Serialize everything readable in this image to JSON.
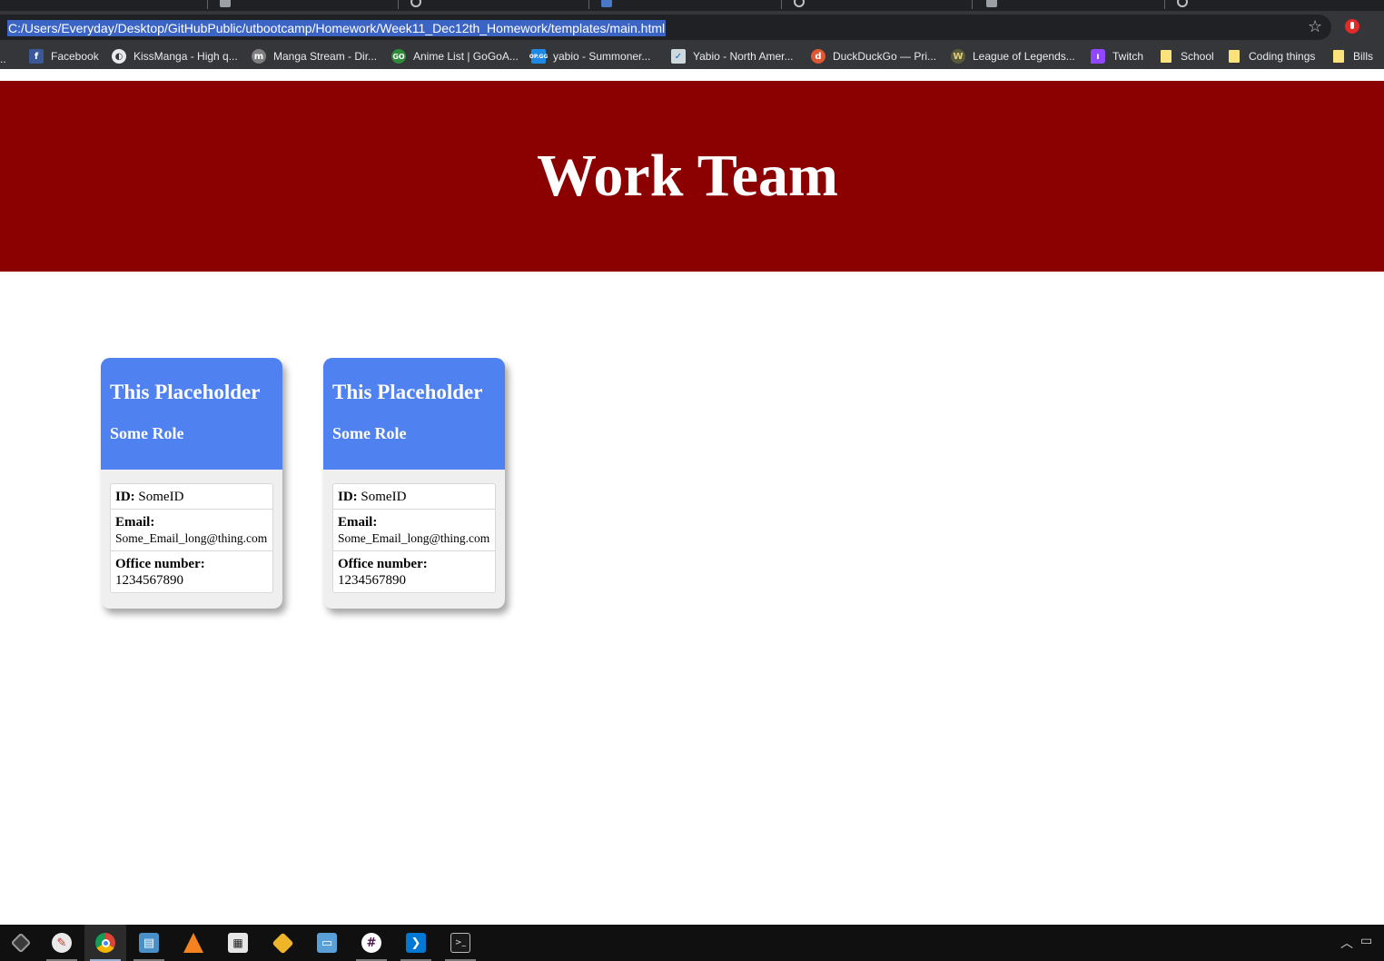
{
  "browser": {
    "url": "C:/Users/Everyday/Desktop/GitHubPublic/utbootcamp/Homework/Week11_Dec12th_Homework/templates/main.html",
    "bookmarks": [
      {
        "label": "Facebook",
        "icon": "facebook-icon"
      },
      {
        "label": "KissManga - High q...",
        "icon": "globe-icon"
      },
      {
        "label": "Manga Stream - Dir...",
        "icon": "manga-stream-icon"
      },
      {
        "label": "Anime List | GoGoA...",
        "icon": "gogoanime-icon"
      },
      {
        "label": "yabio - Summoner...",
        "icon": "opgg-icon"
      },
      {
        "label": "Yabio - North Amer...",
        "icon": "yabio-icon"
      },
      {
        "label": "DuckDuckGo — Pri...",
        "icon": "duckduckgo-icon"
      },
      {
        "label": "League of Legends...",
        "icon": "league-wiki-icon"
      },
      {
        "label": "Twitch",
        "icon": "twitch-icon"
      },
      {
        "label": "School",
        "icon": "folder-icon"
      },
      {
        "label": "Coding things",
        "icon": "folder-icon"
      },
      {
        "label": "Bills",
        "icon": "folder-icon"
      }
    ]
  },
  "page": {
    "title": "Work Team",
    "cards": [
      {
        "name": "This Placeholder",
        "role": "Some Role",
        "id_label": "ID:",
        "id_value": "SomeID",
        "email_label": "Email:",
        "email_value": "Some_Email_long@thing.com",
        "office_label": "Office number:",
        "office_value": "1234567890"
      },
      {
        "name": "This Placeholder",
        "role": "Some Role",
        "id_label": "ID:",
        "id_value": "SomeID",
        "email_label": "Email:",
        "email_value": "Some_Email_long@thing.com",
        "office_label": "Office number:",
        "office_value": "1234567890"
      }
    ]
  },
  "taskbar": {
    "apps": [
      "start-icon",
      "paint-icon",
      "chrome-icon",
      "notes-icon",
      "vlc-icon",
      "calculator-icon",
      "git-icon",
      "chat-icon",
      "slack-icon",
      "vscode-icon",
      "terminal-icon"
    ],
    "active": "chrome-icon"
  },
  "colors": {
    "header_bg": "#8b0000",
    "card_header_bg": "#4f81f0",
    "card_body_bg": "#efefef"
  }
}
